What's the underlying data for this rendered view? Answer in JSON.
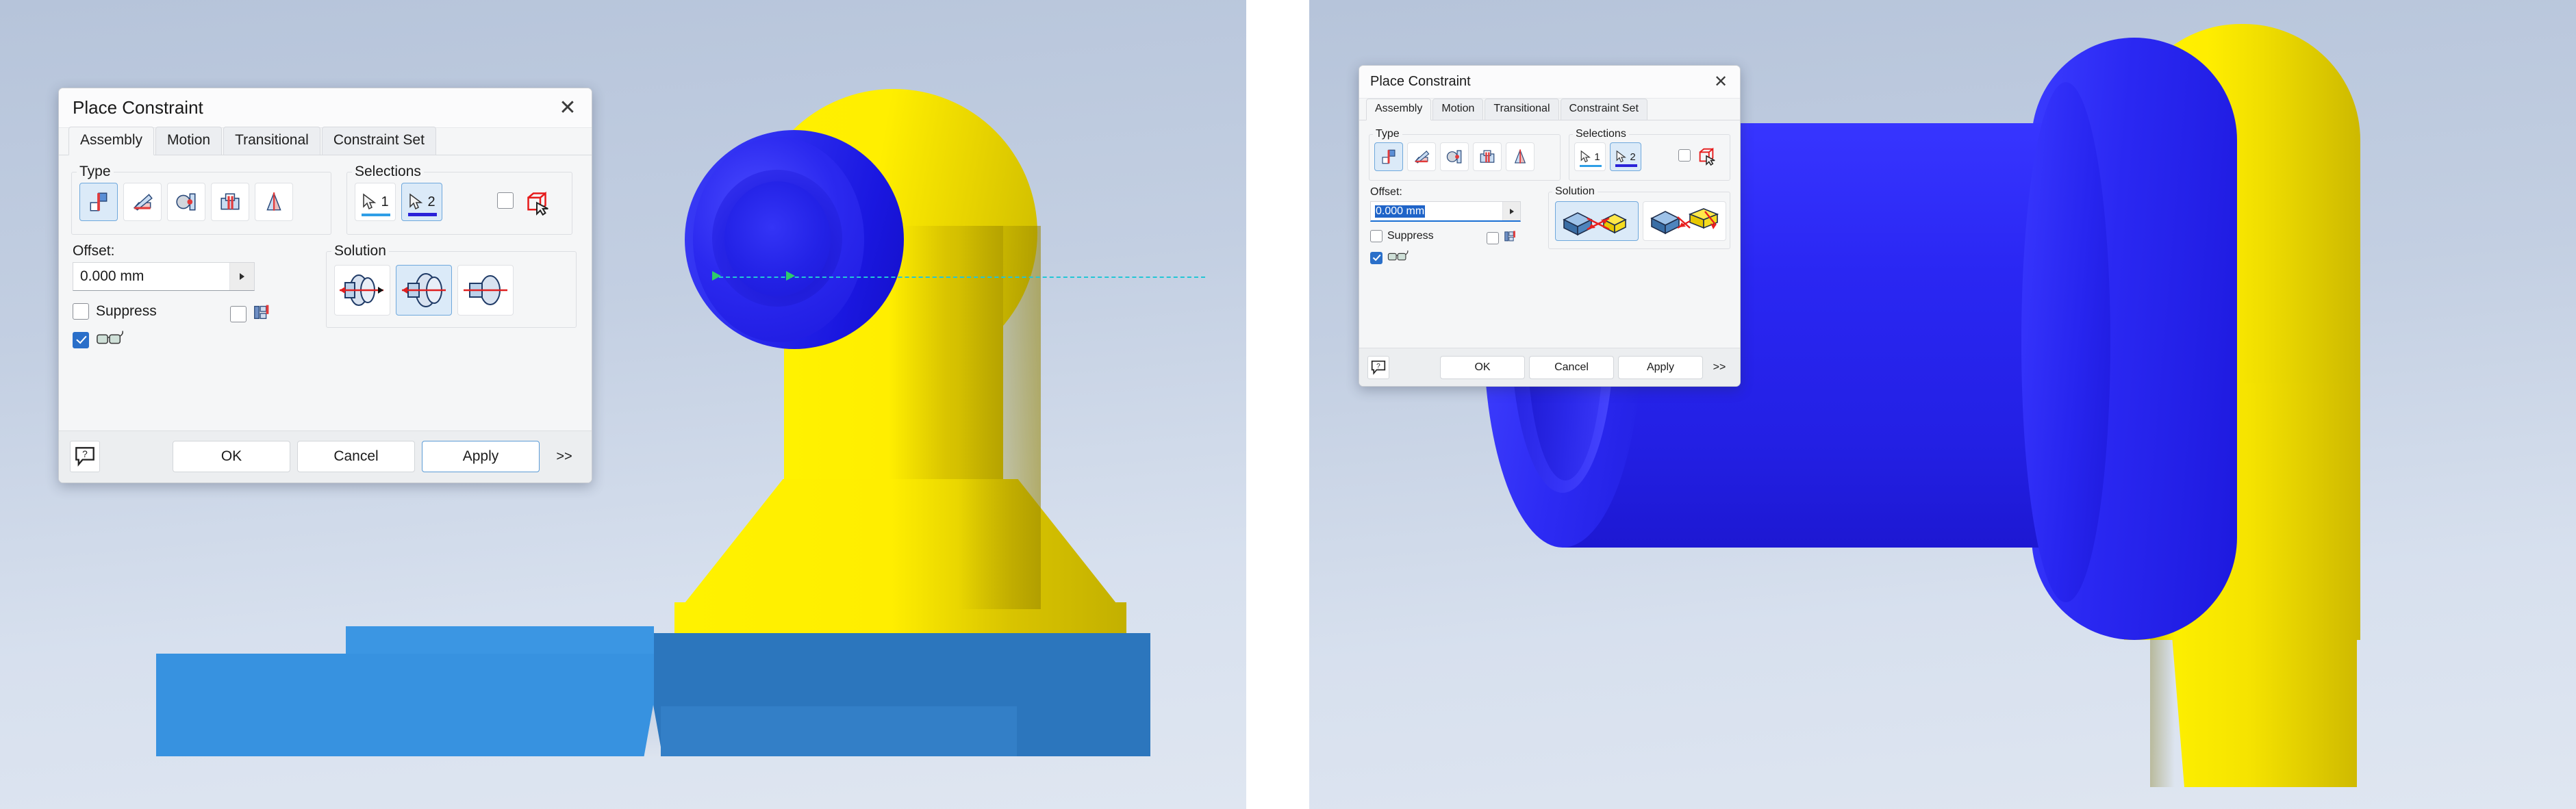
{
  "app": {
    "dialog_title": "Place Constraint",
    "close_glyph": "✕"
  },
  "tabs": [
    {
      "label": "Assembly",
      "active": true
    },
    {
      "label": "Motion",
      "active": false
    },
    {
      "label": "Transitional",
      "active": false
    },
    {
      "label": "Constraint Set",
      "active": false
    }
  ],
  "groups": {
    "type_label": "Type",
    "selections_label": "Selections",
    "solution_label": "Solution"
  },
  "type_buttons": [
    {
      "name": "mate-constraint",
      "selected": true
    },
    {
      "name": "angle-constraint",
      "selected": false
    },
    {
      "name": "tangent-constraint",
      "selected": false
    },
    {
      "name": "insert-constraint",
      "selected": false
    },
    {
      "name": "symmetry-constraint",
      "selected": false
    }
  ],
  "selections": {
    "pick1_label": "1",
    "pick2_label": "2",
    "pick1_selected": false,
    "pick2_selected": true,
    "pick_part_first_checked": false
  },
  "offset": {
    "label": "Offset:",
    "value": "0.000 mm",
    "placeholder": "0.000 mm"
  },
  "checkboxes": {
    "suppress_label": "Suppress",
    "suppress_checked": false,
    "relationship_checked": false,
    "show_preview_checked": true
  },
  "footer": {
    "help_glyph": "?",
    "ok_label": "OK",
    "cancel_label": "Cancel",
    "apply_label": "Apply",
    "more_label": ">>"
  },
  "left_panel": {
    "solutions": [
      {
        "name": "insert-opposed",
        "selected": false
      },
      {
        "name": "insert-aligned",
        "selected": true
      },
      {
        "name": "insert-flush",
        "selected": false
      }
    ],
    "offset_focused": false
  },
  "right_panel": {
    "solutions": [
      {
        "name": "mate-solution",
        "selected": true
      },
      {
        "name": "flush-solution",
        "selected": false
      }
    ],
    "offset_focused": true
  },
  "colors": {
    "accent_blue": "#2a6fc9",
    "select_fill": "#dbeaf8",
    "select_border": "#6fa8dc",
    "model_yellow": "#fff000",
    "model_blue": "#2425ee",
    "base_blue_light": "#3792e0",
    "base_blue_dark": "#2c76bd",
    "axis_cyan": "#22c6d6",
    "axis_green": "#2ecb6a",
    "viewport_bg_top": "#b6c4da",
    "viewport_bg_bottom": "#dfe6f1"
  }
}
